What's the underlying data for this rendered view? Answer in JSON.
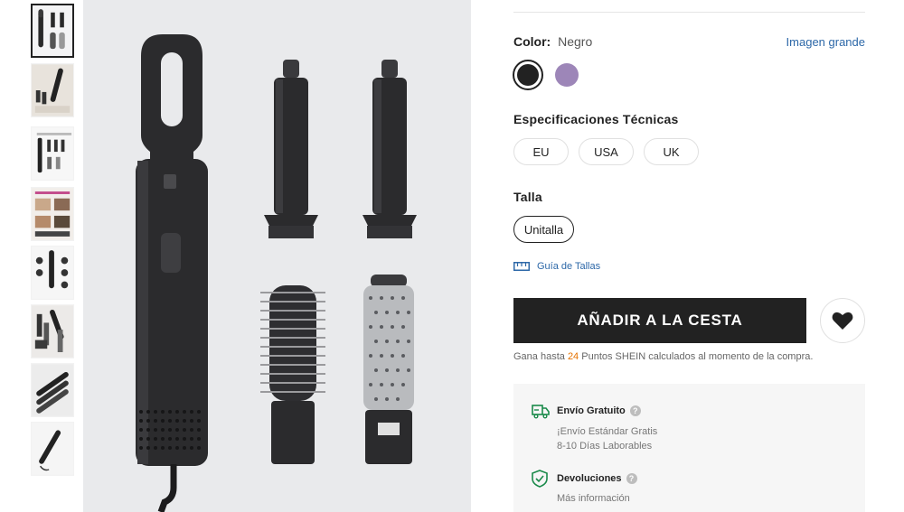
{
  "product": {
    "color_label": "Color:",
    "color_value": "Negro",
    "big_image_link": "Imagen grande",
    "colors": [
      {
        "name": "Negro",
        "hex": "#222222",
        "selected": true
      },
      {
        "name": "Morado",
        "hex": "#9d86b8",
        "selected": false
      }
    ],
    "specs_title": "Especificaciones Técnicas",
    "specs_options": [
      "EU",
      "USA",
      "UK"
    ],
    "size_title": "Talla",
    "size_options": [
      "Unitalla"
    ],
    "size_guide_label": "Guía de Tallas",
    "add_to_cart_label": "AÑADIR A LA CESTA",
    "points_text_before": "Gana hasta",
    "points_value": "24",
    "points_text_after": "Puntos SHEIN calculados al momento de la compra."
  },
  "shipping": {
    "title": "Envío Gratuito",
    "line1": "¡Envío Estándar Gratis",
    "line2": "8-10 Días Laborables",
    "icon": "truck-icon"
  },
  "returns": {
    "title": "Devoluciones",
    "line1": "Más información",
    "icon": "shield-check-icon"
  },
  "theme": {
    "accent_link": "#2d68a8",
    "points_color": "#e57200",
    "button_bg": "#222222",
    "green_icon": "#1a8a4a"
  },
  "gallery": {
    "thumbnail_count": 8,
    "active_index": 0
  }
}
